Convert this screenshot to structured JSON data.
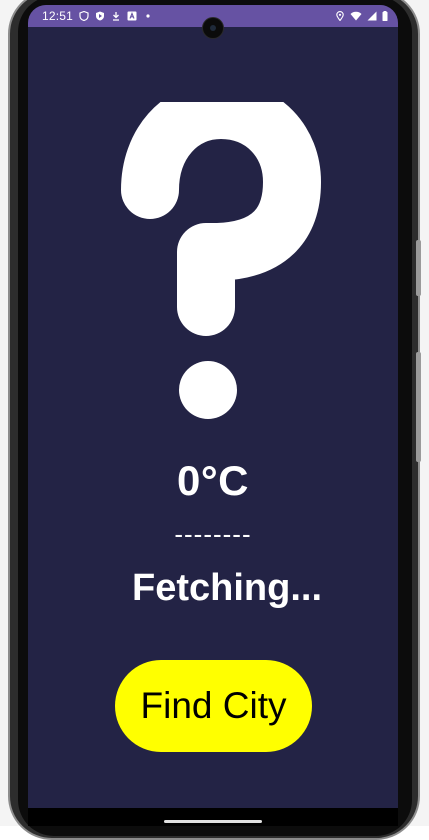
{
  "status_bar": {
    "time": "12:51",
    "left_icons": [
      "shield-icon",
      "play-protect-icon",
      "download-icon",
      "keyboard-icon",
      "dot-icon"
    ],
    "right_icons": [
      "location-icon",
      "wifi-icon",
      "signal-icon",
      "battery-icon"
    ],
    "background": "#6652a3"
  },
  "weather": {
    "icon": "question-mark-icon",
    "temperature": "0°C",
    "condition": "--------",
    "city": "Fetching..."
  },
  "actions": {
    "find_city_label": "Find City"
  },
  "colors": {
    "screen_background": "#232345",
    "button_background": "#ffff00",
    "text": "#ffffff"
  }
}
